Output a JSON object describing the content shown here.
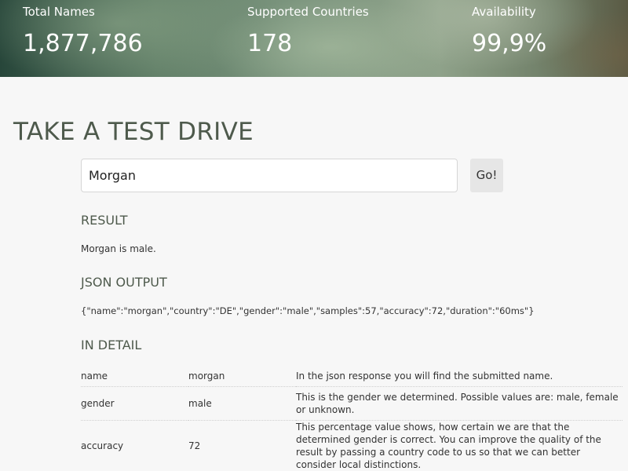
{
  "stats": [
    {
      "label": "Total Names",
      "value": "1,877,786"
    },
    {
      "label": "Supported Countries",
      "value": "178"
    },
    {
      "label": "Availability",
      "value": "99,9%"
    }
  ],
  "test_drive": {
    "title": "TAKE A TEST DRIVE",
    "input_value": "Morgan",
    "go_label": "Go!"
  },
  "result": {
    "heading": "RESULT",
    "text": "Morgan is male."
  },
  "json_output": {
    "heading": "JSON OUTPUT",
    "text": "{\"name\":\"morgan\",\"country\":\"DE\",\"gender\":\"male\",\"samples\":57,\"accuracy\":72,\"duration\":\"60ms\"}"
  },
  "in_detail": {
    "heading": "IN DETAIL",
    "rows": [
      {
        "field": "name",
        "value": "morgan",
        "description": "In the json response you will find the submitted name."
      },
      {
        "field": "gender",
        "value": "male",
        "description": "This is the gender we determined. Possible values are: male, female or unknown."
      },
      {
        "field": "accuracy",
        "value": "72",
        "description": "This percentage value shows, how certain we are that the determined gender is correct. You can improve the quality of the result by passing a country code to us so that we can better consider local distinctions."
      }
    ]
  }
}
